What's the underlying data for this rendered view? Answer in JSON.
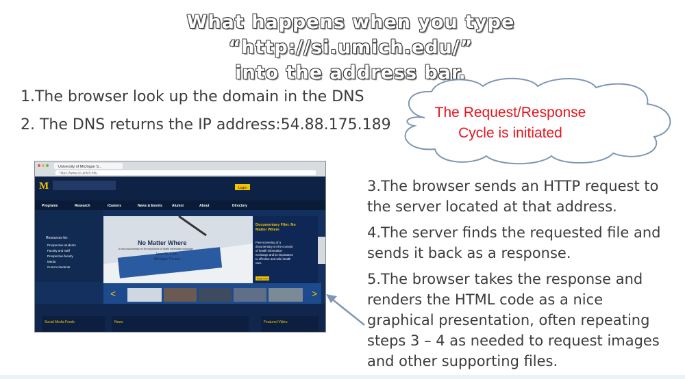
{
  "title": {
    "line1": "What happens when you type",
    "line2": "“http://si.umich.edu/”",
    "line3": "into the address bar."
  },
  "steps": {
    "step1": "1.The browser look up the domain in the DNS",
    "step2": "2. The DNS returns the IP address:54.88.175.189",
    "step3": [
      "3.The browser sends an HTTP request to",
      "the server located at that address."
    ],
    "step4": [
      "4.The server finds the requested file and",
      "sends it back as a response."
    ],
    "step5": [
      "5.The browser takes the response and",
      "renders the HTML code as a nice",
      "graphical presentation, often repeating",
      "steps 3 – 4 as needed to request images",
      "and other supporting files."
    ]
  },
  "cloud": {
    "line1": "The Request/Response",
    "line2": "Cycle is initiated"
  },
  "screenshot": {
    "tab_label": "University of Michigan S...",
    "url": "https://www.si.umich.edu",
    "login": "Login",
    "nav": [
      "Programs",
      "Research",
      "iCareers",
      "News & Events",
      "Alumni",
      "About",
      "Directory"
    ],
    "resources_heading": "Resources for:",
    "resources": [
      "Prospective students",
      "Faculty and staff",
      "Prospective faculty",
      "Media",
      "Current students"
    ],
    "hero_title": "No Matter Where",
    "hero_sub": "A new documentary on the importance of health information exchange",
    "hero_date": "June 29, 4 pm",
    "hero_venue": "Michigan Theater",
    "side_title": [
      "Documentary Film: No",
      "Matter Where"
    ],
    "side_body": [
      "Free screening of a",
      "documentary on the concept",
      "of health information",
      "exchange and its importance",
      "to effective and safe health",
      "care."
    ],
    "read_more": "Read more",
    "social_heading": "Social Media Feeds",
    "news_heading": "News",
    "featured_heading": "Featured Video:"
  },
  "colors": {
    "cloud_text": "#e8141e",
    "step_text": "#3c3c3c",
    "site_bg": "#0f2346",
    "site_gold": "#f2c500"
  }
}
